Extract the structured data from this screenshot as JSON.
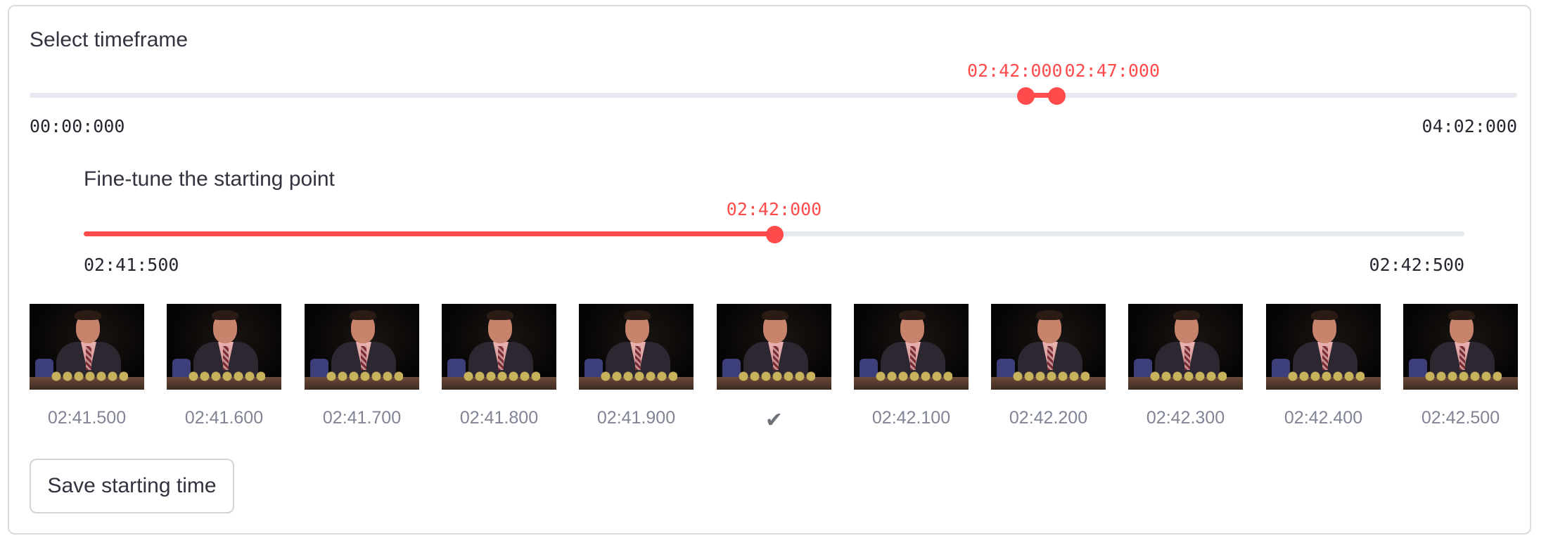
{
  "timeframe": {
    "label": "Select timeframe",
    "min_label": "00:00:000",
    "max_label": "04:02:000",
    "start_value": "02:42:000",
    "end_value": "02:47:000",
    "start_fraction": 0.6694,
    "end_fraction": 0.6901
  },
  "fine_tune": {
    "label": "Fine-tune the starting point",
    "min_label": "02:41:500",
    "max_label": "02:42:500",
    "value": "02:42:000",
    "fraction": 0.5
  },
  "frames": [
    {
      "label": "02:41.500"
    },
    {
      "label": "02:41.600"
    },
    {
      "label": "02:41.700"
    },
    {
      "label": "02:41.800"
    },
    {
      "label": "02:41.900"
    },
    {
      "label": "✔"
    },
    {
      "label": "02:42.100"
    },
    {
      "label": "02:42.200"
    },
    {
      "label": "02:42.300"
    },
    {
      "label": "02:42.400"
    },
    {
      "label": "02:42.500"
    }
  ],
  "save_button": {
    "label": "Save starting time"
  },
  "colors": {
    "accent": "#ff4b4b",
    "track": "#e6e9ef",
    "text": "#31333f",
    "muted": "#808495"
  }
}
